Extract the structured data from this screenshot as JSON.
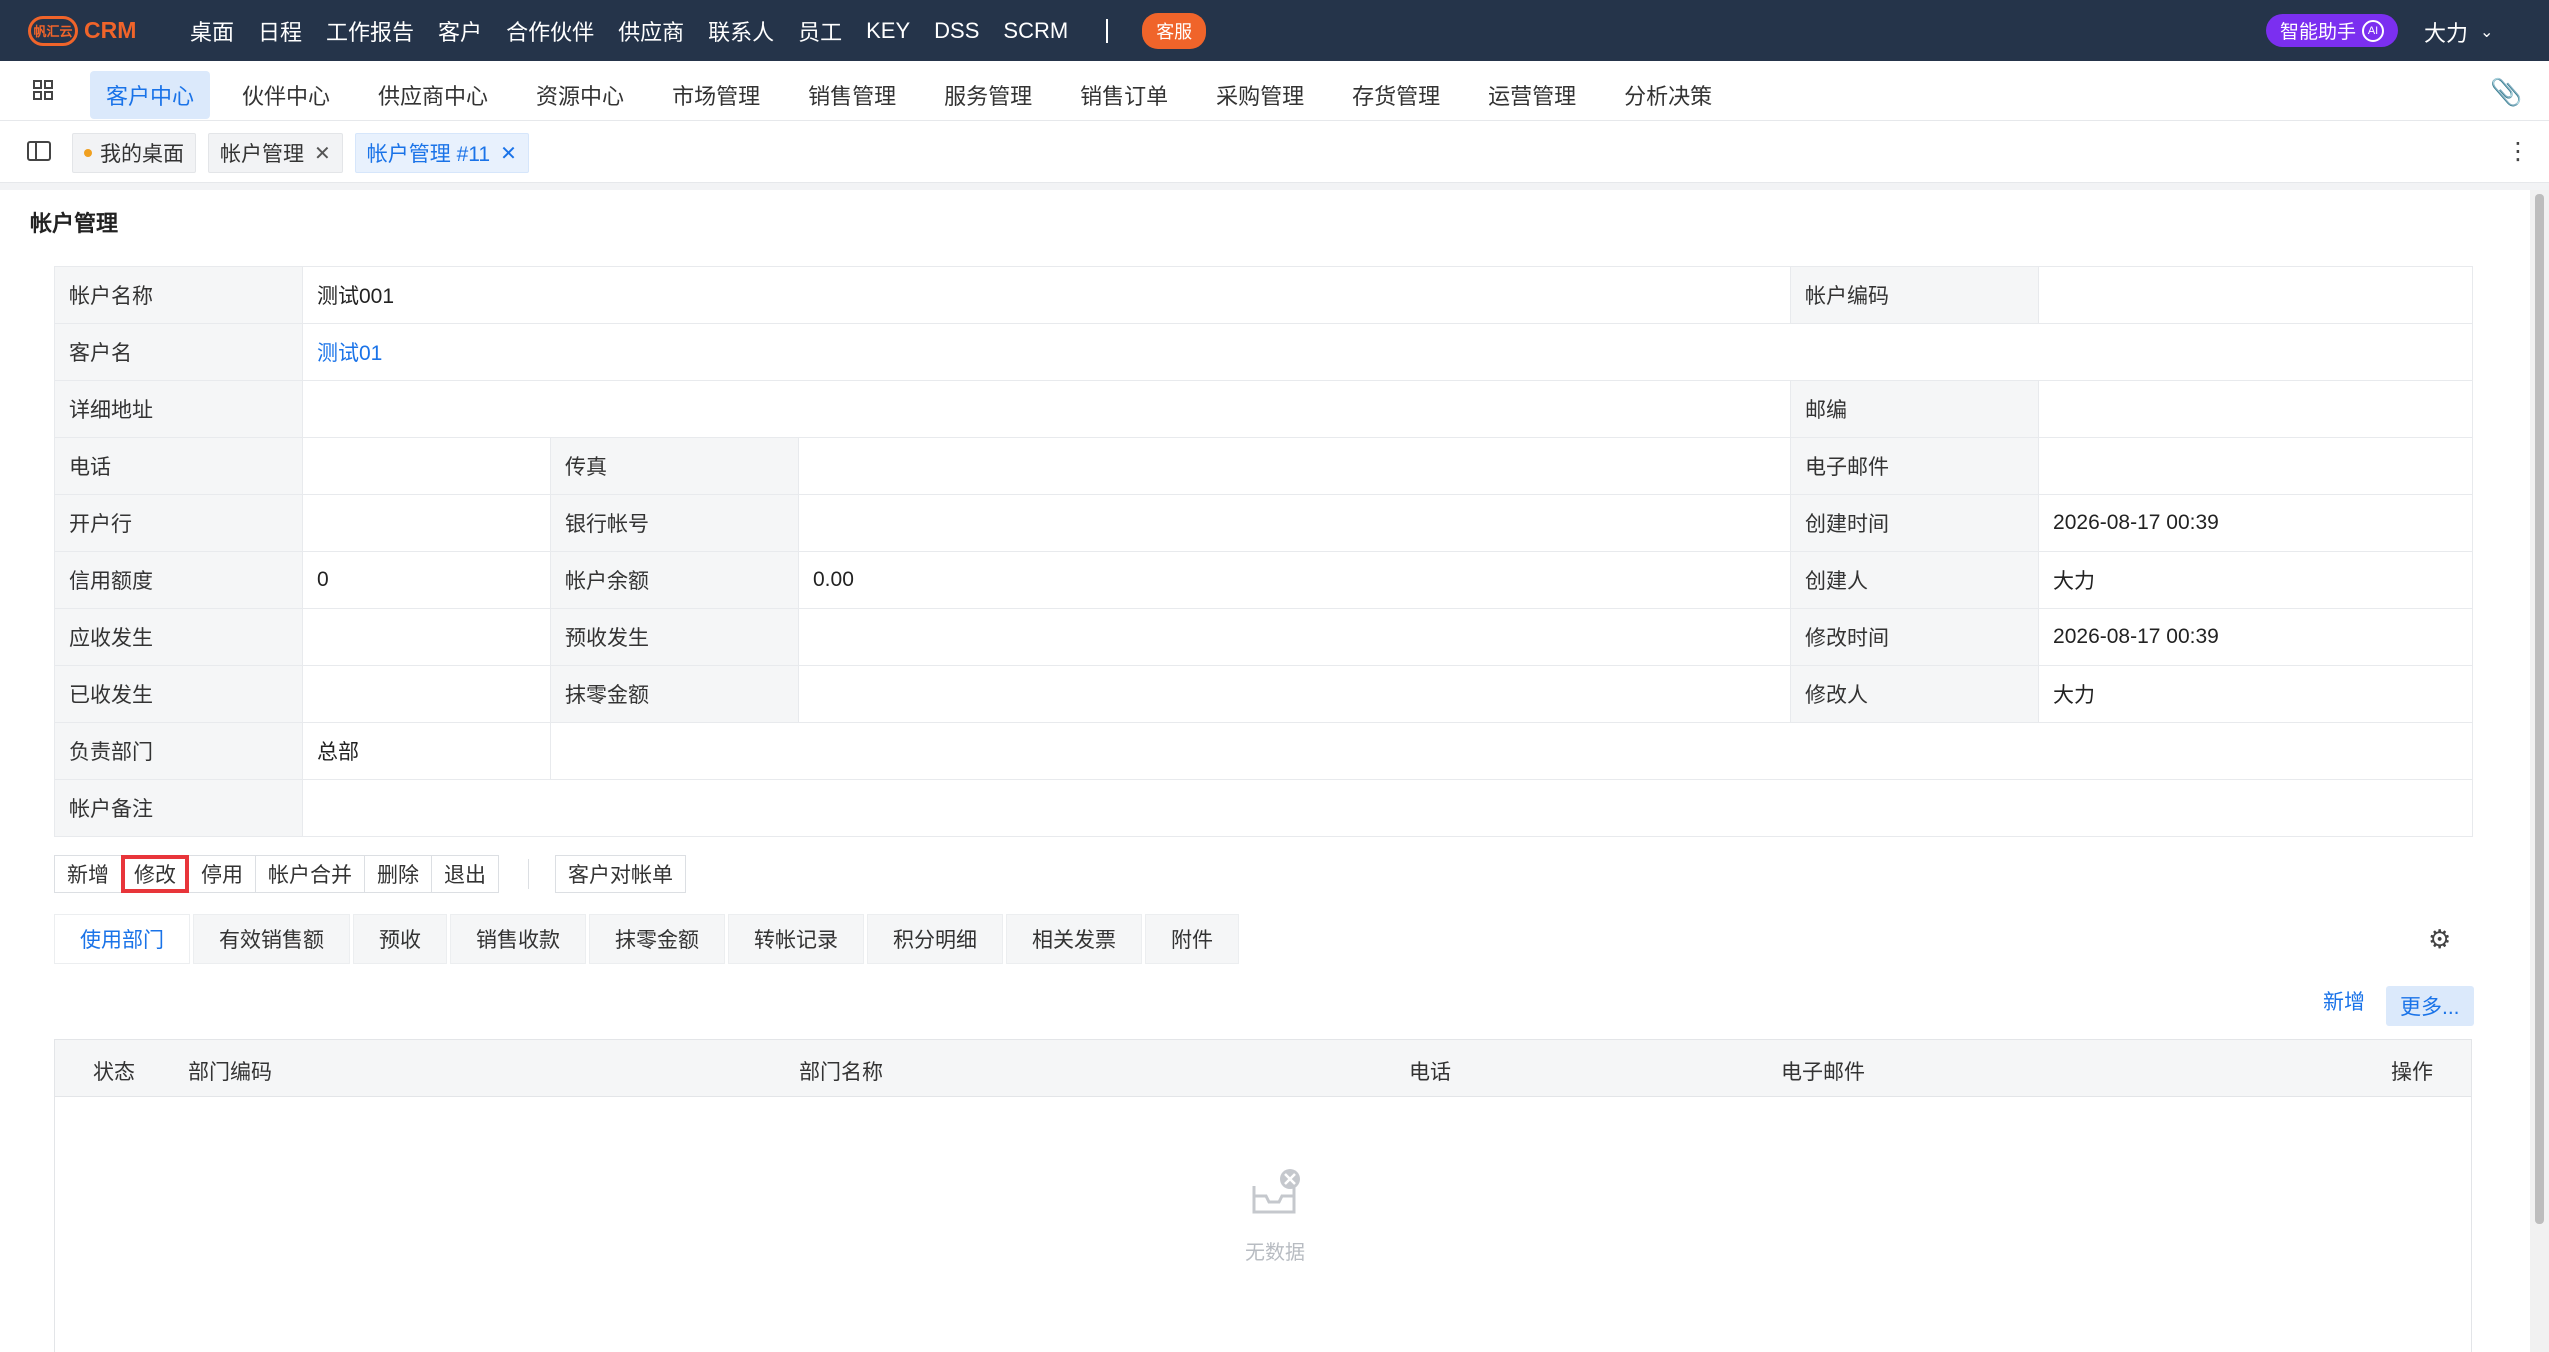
{
  "topbar": {
    "logo_mark": "帆汇云",
    "logo_text": "CRM",
    "nav": [
      "桌面",
      "日程",
      "工作报告",
      "客户",
      "合作伙伴",
      "供应商",
      "联系人",
      "员工",
      "KEY",
      "DSS",
      "SCRM"
    ],
    "service_label": "客服",
    "ai_label": "智能助手",
    "ai_badge": "AI",
    "user_name": "大力"
  },
  "modules": [
    "客户中心",
    "伙伴中心",
    "供应商中心",
    "资源中心",
    "市场管理",
    "销售管理",
    "服务管理",
    "销售订单",
    "采购管理",
    "存货管理",
    "运营管理",
    "分析决策"
  ],
  "tabs": [
    {
      "label": "我的桌面"
    },
    {
      "label": "帐户管理"
    },
    {
      "label": "帐户管理 #11"
    }
  ],
  "page": {
    "title": "帐户管理",
    "fields": {
      "account_name_label": "帐户名称",
      "account_name": "测试001",
      "account_code_label": "帐户编码",
      "account_code": "",
      "customer_label": "客户名",
      "customer": "测试01",
      "address_label": "详细地址",
      "address": "",
      "zip_label": "邮编",
      "zip": "",
      "phone_label": "电话",
      "phone": "",
      "fax_label": "传真",
      "fax": "",
      "email_label": "电子邮件",
      "email": "",
      "bank_label": "开户行",
      "bank": "",
      "bank_account_label": "银行帐号",
      "bank_account": "",
      "created_at_label": "创建时间",
      "created_at": "2026-08-17 00:39",
      "credit_label": "信用额度",
      "credit": "0",
      "balance_label": "帐户余额",
      "balance": "0.00",
      "creator_label": "创建人",
      "creator": "大力",
      "receivable_label": "应收发生",
      "receivable": "",
      "prepay_label": "预收发生",
      "prepay": "",
      "modified_at_label": "修改时间",
      "modified_at": "2026-08-17 00:39",
      "received_label": "已收发生",
      "received": "",
      "rounding_label": "抹零金额",
      "rounding": "",
      "modifier_label": "修改人",
      "modifier": "大力",
      "dept_label": "负责部门",
      "dept": "总部",
      "remark_label": "帐户备注",
      "remark": ""
    },
    "actions": [
      "新增",
      "修改",
      "停用",
      "帐户合并",
      "删除",
      "退出"
    ],
    "statement_button": "客户对帐单",
    "subtabs": [
      "使用部门",
      "有效销售额",
      "预收",
      "销售收款",
      "抹零金额",
      "转帐记录",
      "积分明细",
      "相关发票",
      "附件"
    ],
    "add_link": "新增",
    "more_button": "更多...",
    "grid_columns": [
      "状态",
      "部门编码",
      "部门名称",
      "电话",
      "电子邮件",
      "操作"
    ],
    "empty_text": "无数据"
  },
  "colors": {
    "topbar_bg": "#25344a",
    "brand": "#f0642a",
    "ai": "#7b2ff0",
    "accent": "#1a73e8",
    "highlight": "#e8353a"
  }
}
